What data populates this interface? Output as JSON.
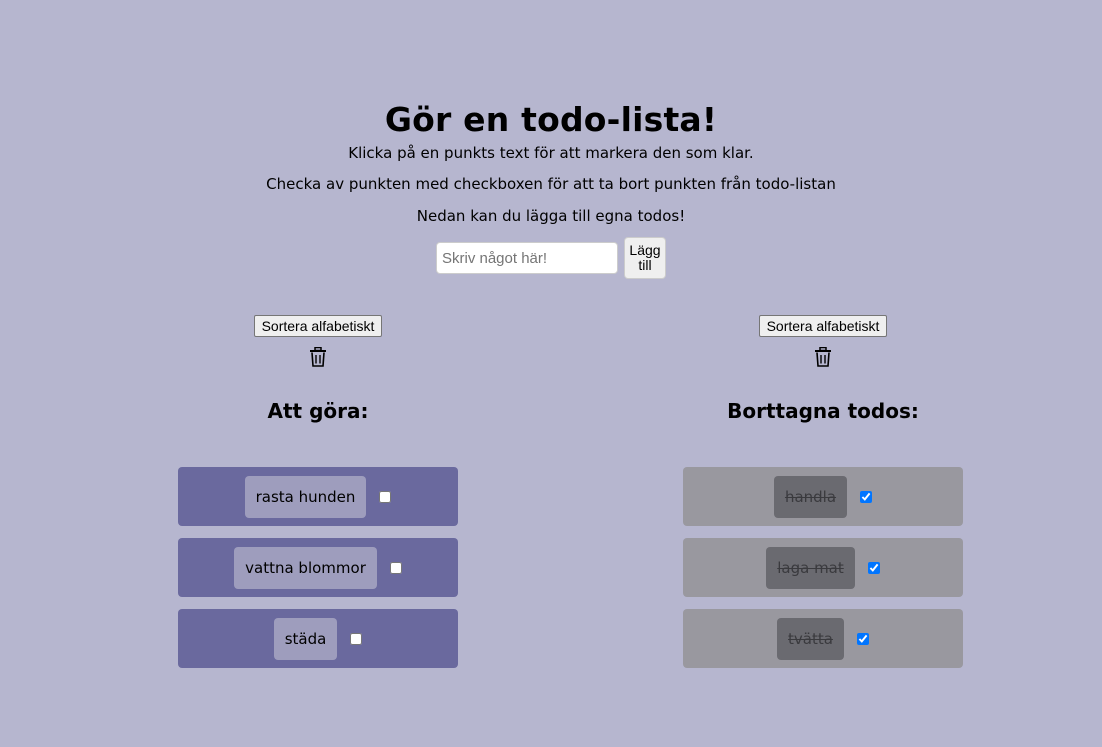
{
  "header": {
    "title": "Gör en todo-lista!",
    "instruction_1": "Klicka på en punkts text för att markera den som klar.",
    "instruction_2": "Checka av punkten med checkboxen för att ta bort punkten från todo-listan",
    "instruction_3": "Nedan kan du lägga till egna todos!"
  },
  "add": {
    "placeholder": "Skriv något här!",
    "value": "",
    "button_label": "Lägg till"
  },
  "todo_column": {
    "sort_label": "Sortera alfabetiskt",
    "trash_icon": "trash-icon",
    "heading": "Att göra:",
    "items": [
      {
        "text": "rasta hunden",
        "checked": false
      },
      {
        "text": "vattna blommor",
        "checked": false
      },
      {
        "text": "städa",
        "checked": false
      }
    ]
  },
  "removed_column": {
    "sort_label": "Sortera alfabetiskt",
    "trash_icon": "trash-icon",
    "heading": "Borttagna todos:",
    "items": [
      {
        "text": "handla",
        "checked": true
      },
      {
        "text": "laga mat",
        "checked": true
      },
      {
        "text": "tvätta",
        "checked": true
      }
    ]
  },
  "colors": {
    "background": "#b6b6cf",
    "todo_card": "#6a699e",
    "todo_label": "#9e9dbd",
    "removed_card": "#99989f",
    "removed_label": "#6a6a70"
  }
}
